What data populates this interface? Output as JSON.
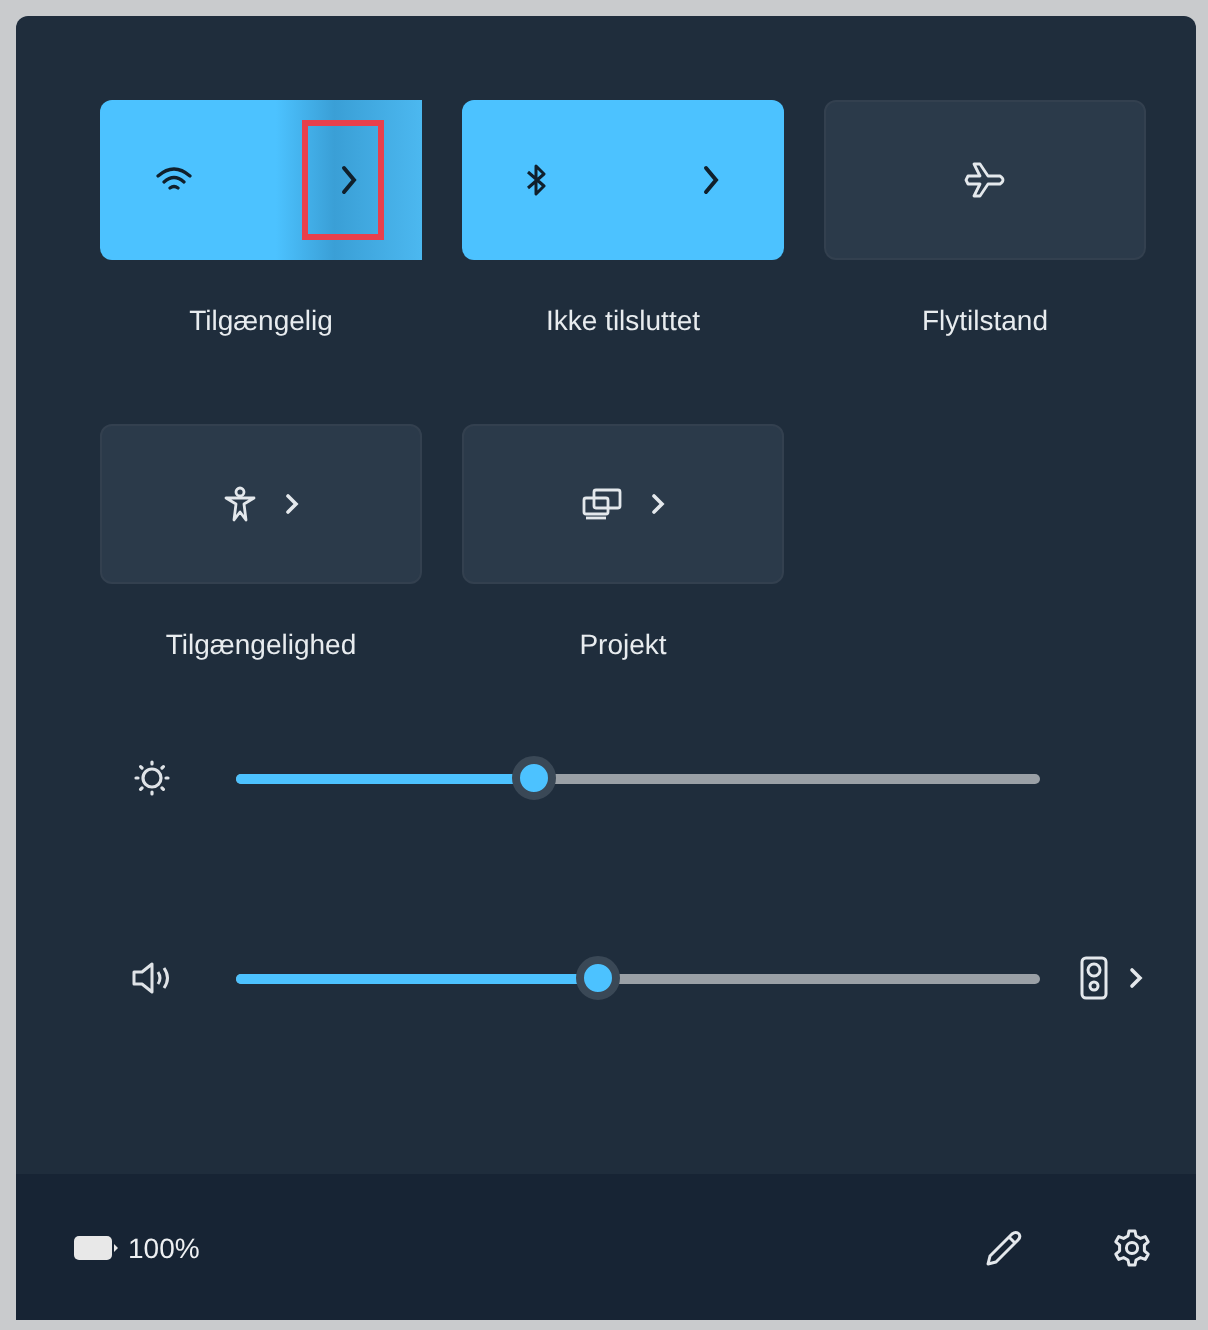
{
  "tiles": [
    {
      "label": "Tilgængelig",
      "on": true,
      "kind": "split",
      "highlighted": true
    },
    {
      "label": "Ikke tilsluttet",
      "on": true,
      "kind": "split",
      "highlighted": false
    },
    {
      "label": "Flytilstand",
      "on": false,
      "kind": "single",
      "highlighted": false
    },
    {
      "label": "Tilgængelighed",
      "on": false,
      "kind": "compact",
      "highlighted": false
    },
    {
      "label": "Projekt",
      "on": false,
      "kind": "compact",
      "highlighted": false
    }
  ],
  "sliders": [
    {
      "kind": "brightness",
      "level": 0.37
    },
    {
      "kind": "volume",
      "level": 0.45
    }
  ],
  "footer": {
    "battery": "100%"
  }
}
